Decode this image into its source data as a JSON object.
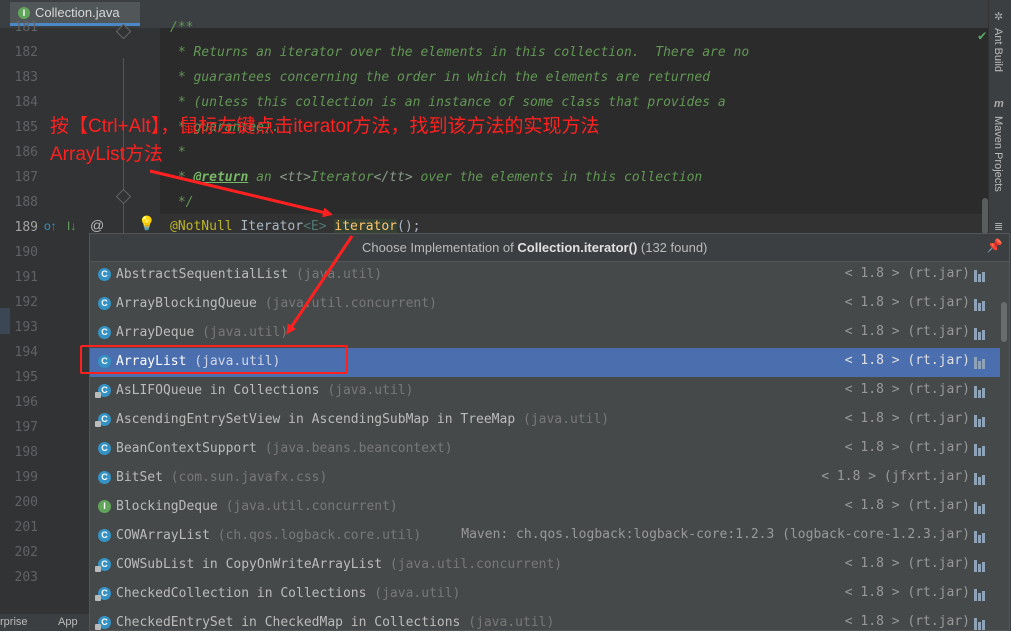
{
  "tab": {
    "label": "Collection.java",
    "icon": "interface-icon"
  },
  "right_tools": {
    "ant_build": "Ant Build",
    "maven_projects": "Maven Projects"
  },
  "line_numbers": [
    "181",
    "182",
    "183",
    "184",
    "185",
    "186",
    "187",
    "188",
    "189",
    "190",
    "191",
    "192",
    "193",
    "194",
    "195",
    "196",
    "197",
    "198",
    "199",
    "200",
    "201",
    "202",
    "203"
  ],
  "code": {
    "l181": "/**",
    "l182": " * Returns an iterator over the elements in this collection.  There are no",
    "l183": " * guarantees concerning the order in which the elements are returned",
    "l184": " * (unless this collection is an instance of some class that provides a",
    "l185": " * guarantee).",
    "l186": " *",
    "l187_star": " * ",
    "l187_tag": "@return",
    "l187_a": " an ",
    "l187_tt1": "<tt>",
    "l187_b": "Iterator",
    "l187_tt2": "</tt>",
    "l187_c": " over the elements in this collection",
    "l188": " */",
    "l189_ann": "@NotNull",
    "l189_type": " Iterator",
    "l189_gen": "<E>",
    "l189_meth": "iterator",
    "l189_end": "();"
  },
  "popup": {
    "title_prefix": "Choose Implementation of ",
    "title_method": "Collection.iterator()",
    "title_suffix": " (132 found)",
    "rows": [
      {
        "name": "AbstractSequentialList",
        "pkg": " (java.util)",
        "loc": "< 1.8 > (rt.jar)",
        "icon": "class-icon",
        "selected": false
      },
      {
        "name": "ArrayBlockingQueue",
        "pkg": " (java.util.concurrent)",
        "loc": "< 1.8 > (rt.jar)",
        "icon": "class-icon",
        "selected": false
      },
      {
        "name": "ArrayDeque",
        "pkg": " (java.util)",
        "loc": "< 1.8 > (rt.jar)",
        "icon": "class-icon",
        "selected": false
      },
      {
        "name": "ArrayList",
        "pkg": " (java.util)",
        "loc": "< 1.8 > (rt.jar)",
        "icon": "class-icon",
        "selected": true
      },
      {
        "name": "AsLIFOQueue in Collections",
        "pkg": " (java.util)",
        "loc": "< 1.8 > (rt.jar)",
        "icon": "inner-class-icon",
        "selected": false
      },
      {
        "name": "AscendingEntrySetView in AscendingSubMap in TreeMap",
        "pkg": " (java.util)",
        "loc": "< 1.8 > (rt.jar)",
        "icon": "inner-class-icon",
        "selected": false
      },
      {
        "name": "BeanContextSupport",
        "pkg": " (java.beans.beancontext)",
        "loc": "< 1.8 > (rt.jar)",
        "icon": "class-icon",
        "selected": false
      },
      {
        "name": "BitSet",
        "pkg": " (com.sun.javafx.css)",
        "loc": "< 1.8 > (jfxrt.jar)",
        "icon": "class-icon",
        "selected": false
      },
      {
        "name": "BlockingDeque",
        "pkg": " (java.util.concurrent)",
        "loc": "< 1.8 > (rt.jar)",
        "icon": "interface-icon",
        "selected": false
      },
      {
        "name": "COWArrayList",
        "pkg": " (ch.qos.logback.core.util)",
        "loc": "Maven: ch.qos.logback:logback-core:1.2.3 (logback-core-1.2.3.jar)",
        "icon": "class-icon",
        "selected": false
      },
      {
        "name": "COWSubList in CopyOnWriteArrayList",
        "pkg": " (java.util.concurrent)",
        "loc": "< 1.8 > (rt.jar)",
        "icon": "inner-class-icon",
        "selected": false
      },
      {
        "name": "CheckedCollection in Collections",
        "pkg": " (java.util)",
        "loc": "< 1.8 > (rt.jar)",
        "icon": "inner-class-icon",
        "selected": false
      },
      {
        "name": "CheckedEntrySet in CheckedMap in Collections",
        "pkg": " (java.util)",
        "loc": "< 1.8 > (rt.jar)",
        "icon": "inner-class-icon",
        "selected": false
      }
    ]
  },
  "annotation": {
    "line1": "按【Ctrl+Alt】，鼠标左键点击iterator方法，找到该方法的实现方法",
    "line2": "ArrayList方法"
  },
  "bottom": {
    "item1": "rprise",
    "item2": "App"
  },
  "colors": {
    "selection": "#4b6eaf",
    "annotation_red": "#ff2020",
    "comment_green": "#629755"
  }
}
